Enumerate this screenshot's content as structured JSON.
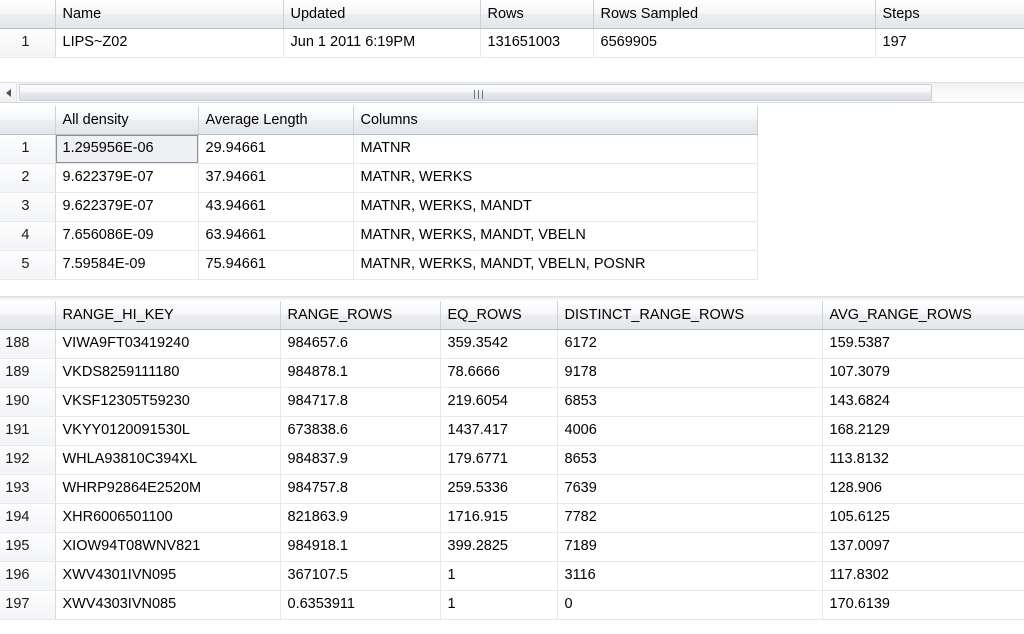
{
  "app": {
    "kind": "sql-results-grid",
    "accent_header_bg": "#e8eaee",
    "grid_line_color": "#e6e8eb",
    "selection_border_color": "#8a8f96"
  },
  "grid_statistics_header": {
    "name": "grid-statistics-header",
    "columns": [
      "Name",
      "Updated",
      "Rows",
      "Rows Sampled",
      "Steps"
    ],
    "rows": [
      {
        "num": "1",
        "cells": [
          "LIPS~Z02",
          "Jun  1 2011  6:19PM",
          "131651003",
          "6569905",
          "197"
        ]
      }
    ]
  },
  "scrollbar": {
    "name": "horizontal-scrollbar",
    "left_arrow": "◀",
    "grip": "|||",
    "thumb_position_pct": 0,
    "thumb_size_pct": 95
  },
  "grid_density": {
    "name": "grid-density-vector",
    "columns": [
      "All density",
      "Average Length",
      "Columns"
    ],
    "selected_cell": {
      "row": 1,
      "column": "All density",
      "value": "1.295956E-06"
    },
    "rows": [
      {
        "num": "1",
        "cells": [
          "1.295956E-06",
          "29.94661",
          "MATNR"
        ]
      },
      {
        "num": "2",
        "cells": [
          "9.622379E-07",
          "37.94661",
          "MATNR, WERKS"
        ]
      },
      {
        "num": "3",
        "cells": [
          "9.622379E-07",
          "43.94661",
          "MATNR, WERKS, MANDT"
        ]
      },
      {
        "num": "4",
        "cells": [
          "7.656086E-09",
          "63.94661",
          "MATNR, WERKS, MANDT, VBELN"
        ]
      },
      {
        "num": "5",
        "cells": [
          "7.59584E-09",
          "75.94661",
          "MATNR, WERKS, MANDT, VBELN, POSNR"
        ]
      }
    ]
  },
  "grid_histogram": {
    "name": "grid-histogram-steps",
    "columns": [
      "RANGE_HI_KEY",
      "RANGE_ROWS",
      "EQ_ROWS",
      "DISTINCT_RANGE_ROWS",
      "AVG_RANGE_ROWS"
    ],
    "rows": [
      {
        "num": "188",
        "cells": [
          "VIWA9FT03419240",
          "984657.6",
          "359.3542",
          "6172",
          "159.5387"
        ]
      },
      {
        "num": "189",
        "cells": [
          "VKDS8259111180",
          "984878.1",
          "78.6666",
          "9178",
          "107.3079"
        ]
      },
      {
        "num": "190",
        "cells": [
          "VKSF12305T59230",
          "984717.8",
          "219.6054",
          "6853",
          "143.6824"
        ]
      },
      {
        "num": "191",
        "cells": [
          "VKYY0120091530L",
          "673838.6",
          "1437.417",
          "4006",
          "168.2129"
        ]
      },
      {
        "num": "192",
        "cells": [
          "WHLA93810C394XL",
          "984837.9",
          "179.6771",
          "8653",
          "113.8132"
        ]
      },
      {
        "num": "193",
        "cells": [
          "WHRP92864E2520M",
          "984757.8",
          "259.5336",
          "7639",
          "128.906"
        ]
      },
      {
        "num": "194",
        "cells": [
          "XHR6006501100",
          "821863.9",
          "1716.915",
          "7782",
          "105.6125"
        ]
      },
      {
        "num": "195",
        "cells": [
          "XIOW94T08WNV821",
          "984918.1",
          "399.2825",
          "7189",
          "137.0097"
        ]
      },
      {
        "num": "196",
        "cells": [
          "XWV4301IVN095",
          "367107.5",
          "1",
          "3116",
          "117.8302"
        ]
      },
      {
        "num": "197",
        "cells": [
          "XWV4303IVN085",
          "0.6353911",
          "1",
          "0",
          "170.6139"
        ]
      }
    ]
  }
}
